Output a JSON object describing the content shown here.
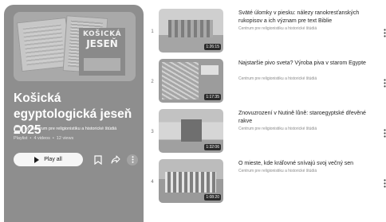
{
  "playlist": {
    "cover_text_line1": "KOŠICKÁ",
    "cover_text_line2": "JESEŇ",
    "title": "Košická egyptologická jeseň 2025",
    "owner": "by Centrum pre religionistiku a historické štúdiá",
    "type": "Playlist",
    "videos_count": "4 videos",
    "views": "12 views",
    "play_all_label": "Play all",
    "save_icon": "bookmark-icon",
    "share_icon": "share-icon",
    "more_icon": "more-vert-icon"
  },
  "videos": [
    {
      "index": "1",
      "title": "Sväté úlomky v piesku: nálezy ranokresťanských rukopisov a ich význam pre text Biblie",
      "channel": "Centrum pre religionistiku a historické štúdiá",
      "duration": "1:26:15"
    },
    {
      "index": "2",
      "title": "Najstaršie pivo sveta? Výroba piva v starom Egypte",
      "channel": "Centrum pre religionistiku a historické štúdiá",
      "duration": "1:17:35"
    },
    {
      "index": "3",
      "title": "Znovuzrození v Nutině lůně: staroegyptské dřevěné rakve",
      "channel": "Centrum pre religionistiku a historické štúdiá",
      "duration": "1:32:06"
    },
    {
      "index": "4",
      "title": "O mieste, kde kráľovné snívajú svoj večný sen",
      "channel": "Centrum pre religionistiku a historické štúdiá",
      "duration": "1:08:20"
    }
  ]
}
